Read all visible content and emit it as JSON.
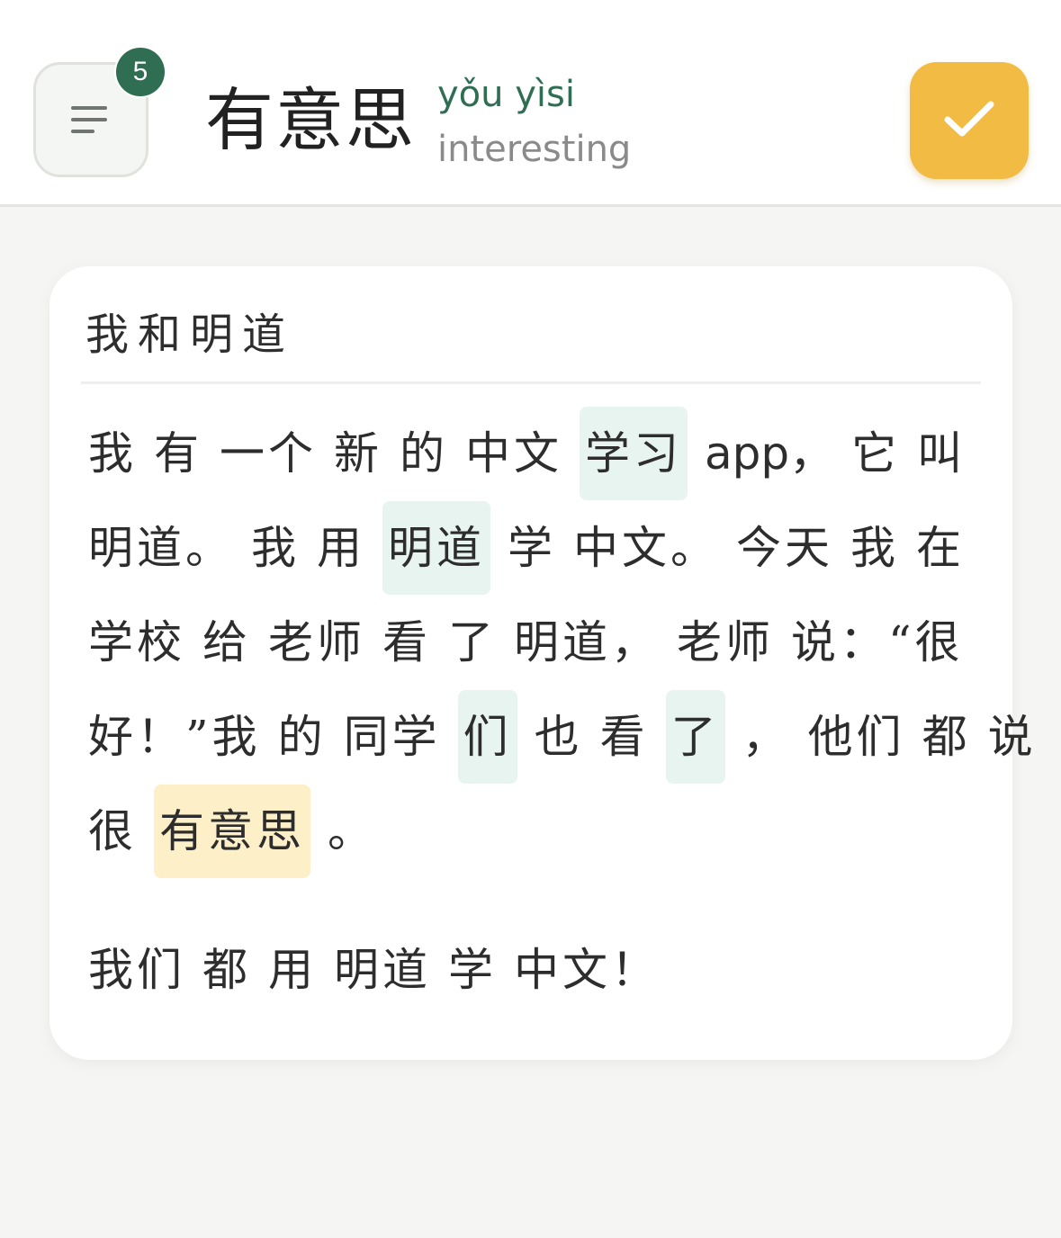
{
  "header": {
    "menu_badge": "5",
    "word": "有意思",
    "pinyin": "yǒu yìsi",
    "meaning": "interesting",
    "menu_icon": "menu-lines-icon",
    "confirm_icon": "check-icon",
    "colors": {
      "accent_green": "#2f6e53",
      "confirm_yellow": "#f2bb44",
      "highlight_green": "#e8f4f0",
      "highlight_yellow": "#fdf0c8"
    }
  },
  "passage": {
    "title": "我和明道",
    "lines": [
      [
        {
          "t": "我"
        },
        {
          "t": "有"
        },
        {
          "t": "一个"
        },
        {
          "t": "新"
        },
        {
          "t": "的"
        },
        {
          "t": "中文"
        },
        {
          "t": "学习",
          "hl": "green"
        },
        {
          "t": "app，",
          "latin": true
        },
        {
          "t": "它"
        },
        {
          "t": "叫"
        }
      ],
      [
        {
          "t": "明道。"
        },
        {
          "t": "我"
        },
        {
          "t": "用"
        },
        {
          "t": "明道",
          "hl": "green"
        },
        {
          "t": "学"
        },
        {
          "t": "中文。"
        },
        {
          "t": "今天"
        },
        {
          "t": "我"
        },
        {
          "t": "在"
        }
      ],
      [
        {
          "t": "学校"
        },
        {
          "t": "给"
        },
        {
          "t": "老师"
        },
        {
          "t": "看"
        },
        {
          "t": "了"
        },
        {
          "t": "明道，"
        },
        {
          "t": "老师"
        },
        {
          "t": "说：“很"
        }
      ],
      [
        {
          "t": "好！”我"
        },
        {
          "t": "的"
        },
        {
          "t": "同学"
        },
        {
          "t": "们",
          "hl": "green"
        },
        {
          "t": "也"
        },
        {
          "t": "看"
        },
        {
          "t": "了",
          "hl": "green"
        },
        {
          "t": "，"
        },
        {
          "t": "他们"
        },
        {
          "t": "都"
        },
        {
          "t": "说"
        }
      ],
      [
        {
          "t": "很"
        },
        {
          "t": "有意思",
          "hl": "yellow"
        },
        {
          "t": "。"
        }
      ]
    ],
    "closing": [
      {
        "t": "我们"
      },
      {
        "t": "都"
      },
      {
        "t": "用"
      },
      {
        "t": "明道"
      },
      {
        "t": "学"
      },
      {
        "t": "中文！"
      }
    ]
  }
}
